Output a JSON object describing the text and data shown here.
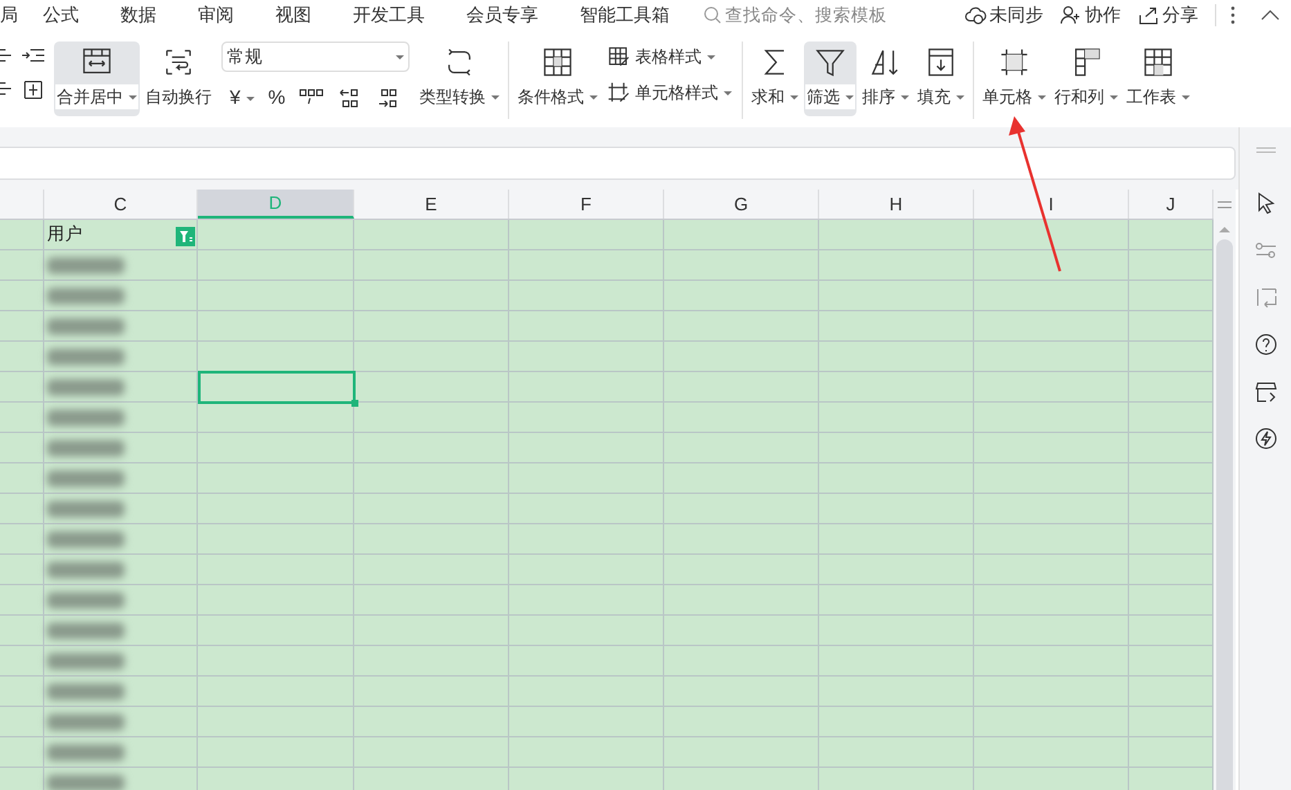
{
  "menu_tabs": [
    "局",
    "公式",
    "数据",
    "审阅",
    "视图",
    "开发工具",
    "会员专享",
    "智能工具箱"
  ],
  "search": {
    "placeholder": "查找命令、搜索模板"
  },
  "top_actions": [
    {
      "kind": "sync",
      "label": "未同步"
    },
    {
      "kind": "collab",
      "label": "协作"
    },
    {
      "kind": "share",
      "label": "分享"
    }
  ],
  "ribbon": [
    {
      "kind": "big",
      "label": "合并居中",
      "dropdown": true,
      "pressed": true
    },
    {
      "kind": "big",
      "label": "自动换行",
      "dropdown": false,
      "pressed": false
    },
    {
      "kind": "number",
      "format": "常规",
      "currency": "¥",
      "percent": "%"
    },
    {
      "kind": "big",
      "label": "类型转换",
      "dropdown": true,
      "pressed": false
    },
    {
      "kind": "sep"
    },
    {
      "kind": "big",
      "label": "条件格式",
      "dropdown": true,
      "pressed": false
    },
    {
      "kind": "pair",
      "items": [
        {
          "label": "表格样式"
        },
        {
          "label": "单元格样式"
        }
      ]
    },
    {
      "kind": "sep"
    },
    {
      "kind": "big",
      "label": "求和",
      "dropdown": true,
      "pressed": false
    },
    {
      "kind": "big",
      "label": "筛选",
      "dropdown": true,
      "pressed": true
    },
    {
      "kind": "big",
      "label": "排序",
      "dropdown": true,
      "pressed": false
    },
    {
      "kind": "big",
      "label": "填充",
      "dropdown": true,
      "pressed": false
    },
    {
      "kind": "sep"
    },
    {
      "kind": "big",
      "label": "单元格",
      "dropdown": true,
      "pressed": false
    },
    {
      "kind": "big",
      "label": "行和列",
      "dropdown": true,
      "pressed": false
    },
    {
      "kind": "big",
      "label": "工作表",
      "dropdown": true,
      "pressed": false
    }
  ],
  "columns": [
    {
      "label": "C",
      "selected": false
    },
    {
      "label": "D",
      "selected": true
    },
    {
      "label": "E",
      "selected": false
    },
    {
      "label": "F",
      "selected": false
    },
    {
      "label": "G",
      "selected": false
    },
    {
      "label": "H",
      "selected": false
    },
    {
      "label": "I",
      "selected": false
    },
    {
      "label": "J",
      "selected": false
    }
  ],
  "header_cell": {
    "text": "用户",
    "filtered": true
  }
}
